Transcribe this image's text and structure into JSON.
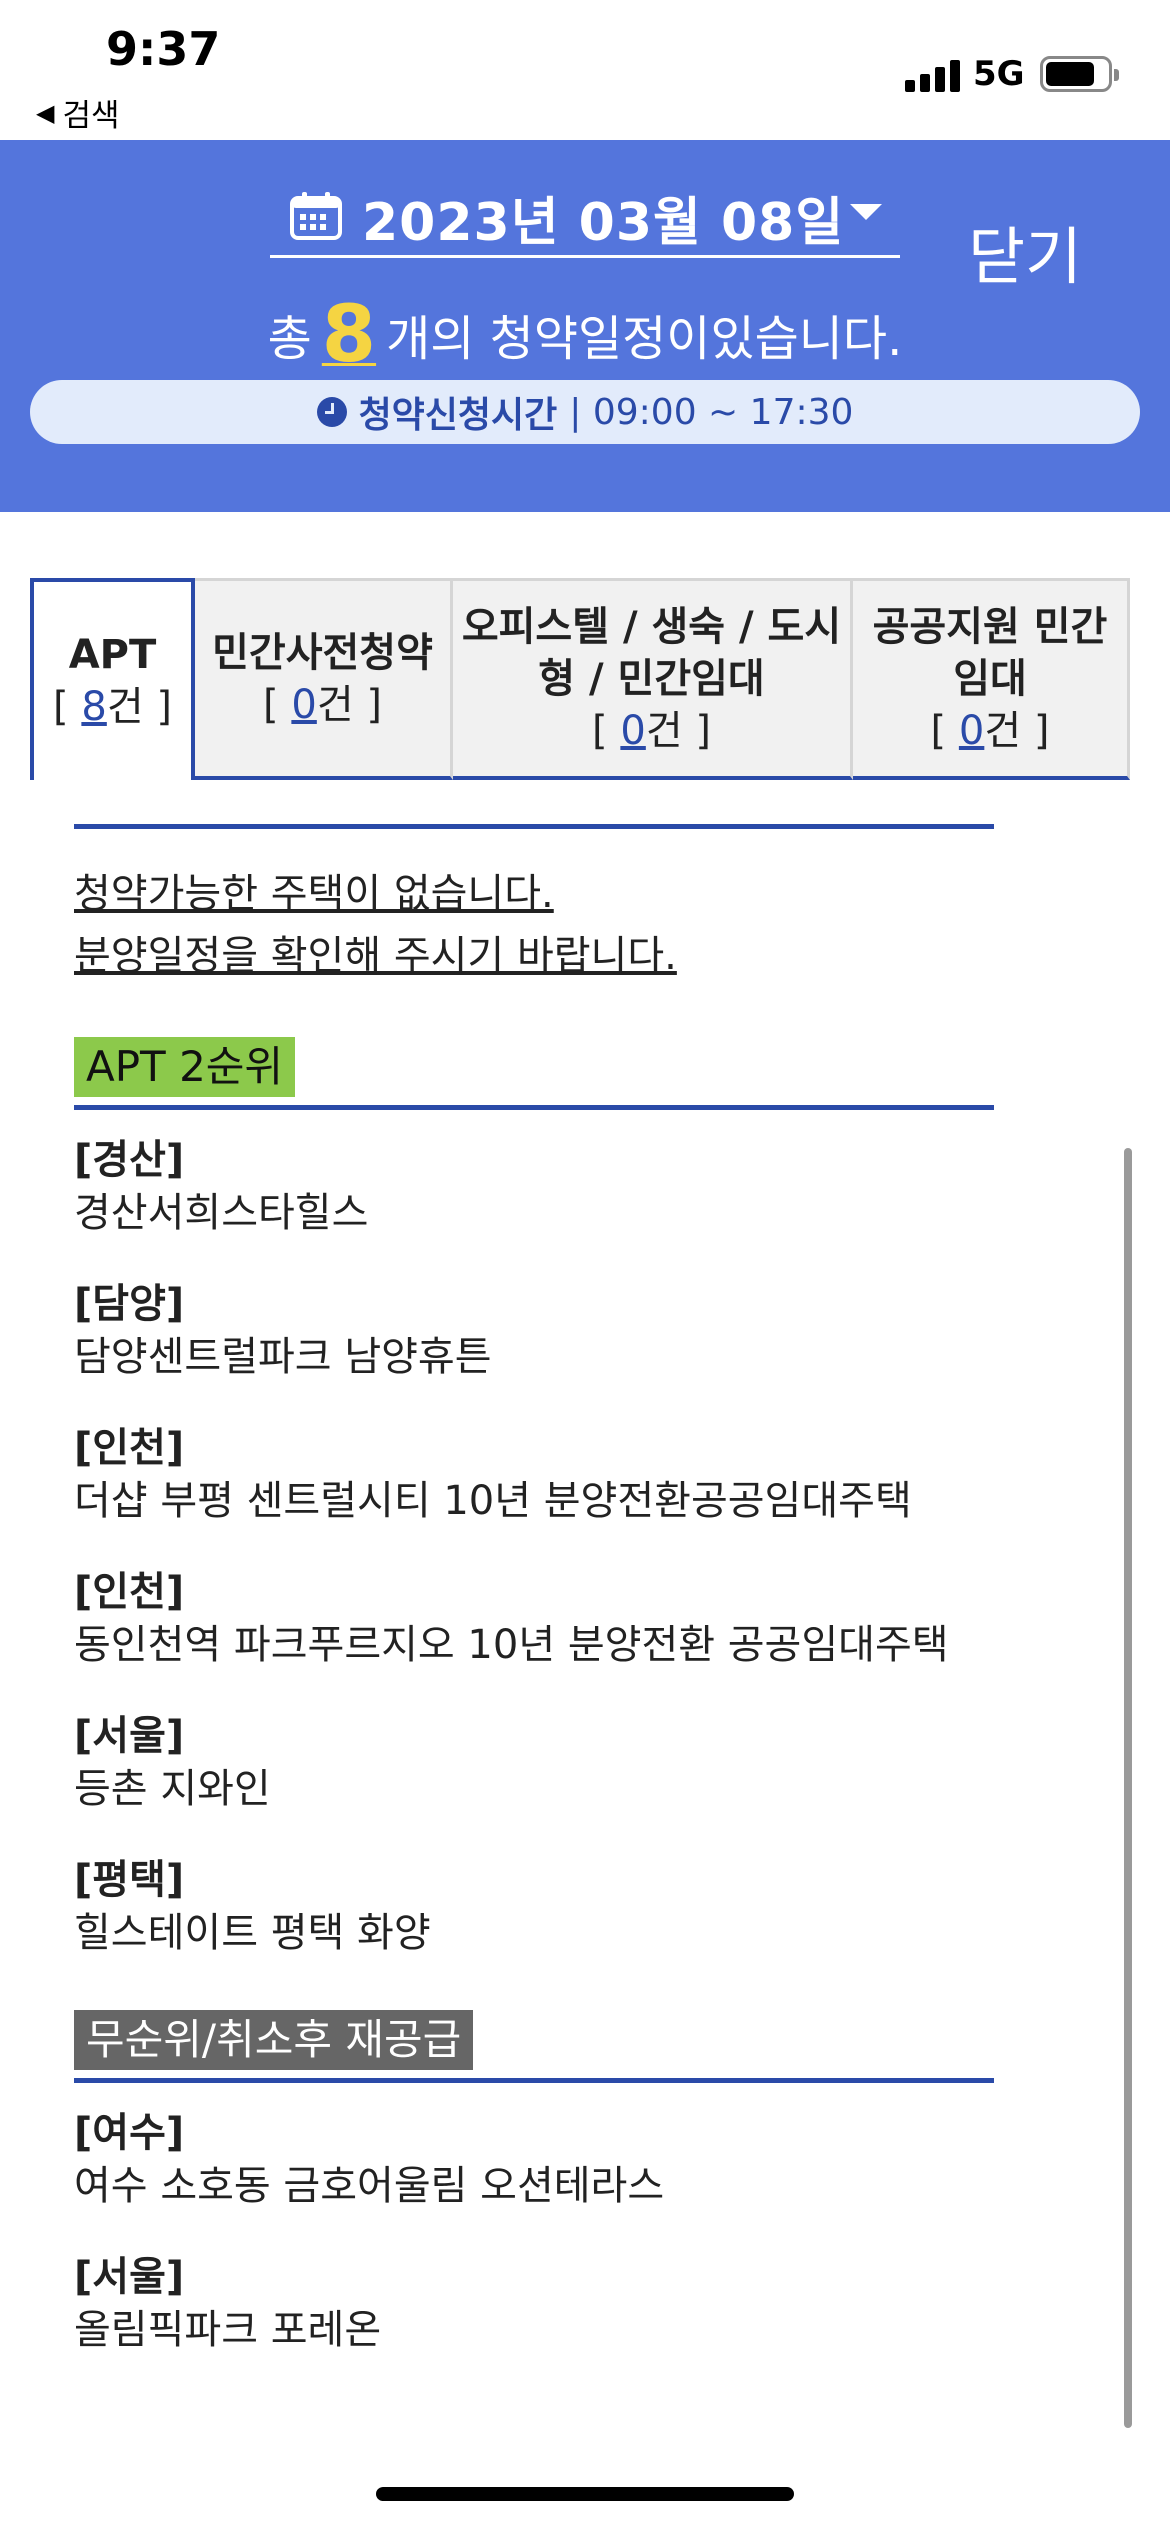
{
  "status_bar": {
    "time": "9:37",
    "back_label": "검색",
    "network": "5G",
    "battery_level": 0.75
  },
  "header": {
    "date": "2023년 03월 08일",
    "close_label": "닫기",
    "summary_prefix": "총",
    "summary_count": "8",
    "summary_suffix": "개의 청약일정이있습니다.",
    "time_label": "청약신청시간",
    "time_range": "| 09:00 ~ 17:30",
    "accent_color": "#5475dc",
    "count_color": "#f5d442"
  },
  "tabs": [
    {
      "label": "APT",
      "count_prefix": "[ ",
      "count": "8",
      "count_suffix": "건 ]"
    },
    {
      "label": "민간사전청약",
      "count_prefix": "[ ",
      "count": "0",
      "count_suffix": "건 ]"
    },
    {
      "label": "오피스텔 / 생숙 / 도시형 / 민간임대",
      "count_prefix": "[ ",
      "count": "0",
      "count_suffix": "건 ]"
    },
    {
      "label": "공공지원 민간임대",
      "count_prefix": "[ ",
      "count": "0",
      "count_suffix": "건 ]"
    }
  ],
  "notice": {
    "line1": "청약가능한 주택이 없습니다.",
    "line2": "분양일정을 확인해 주시기 바랍니다."
  },
  "sections": [
    {
      "title": "APT 2순위",
      "items": [
        {
          "region": "[경산]",
          "name": "경산서희스타힐스"
        },
        {
          "region": "[담양]",
          "name": "담양센트럴파크 남양휴튼"
        },
        {
          "region": "[인천]",
          "name": "더샵 부평 센트럴시티 10년 분양전환공공임대주택"
        },
        {
          "region": "[인천]",
          "name": "동인천역 파크푸르지오 10년 분양전환 공공임대주택"
        },
        {
          "region": "[서울]",
          "name": "등촌 지와인"
        },
        {
          "region": "[평택]",
          "name": "힐스테이트 평택 화양"
        }
      ]
    },
    {
      "title": "무순위/취소후 재공급",
      "items": [
        {
          "region": "[여수]",
          "name": "여수 소호동 금호어울림 오션테라스"
        },
        {
          "region": "[서울]",
          "name": "올림픽파크 포레온"
        }
      ]
    }
  ]
}
